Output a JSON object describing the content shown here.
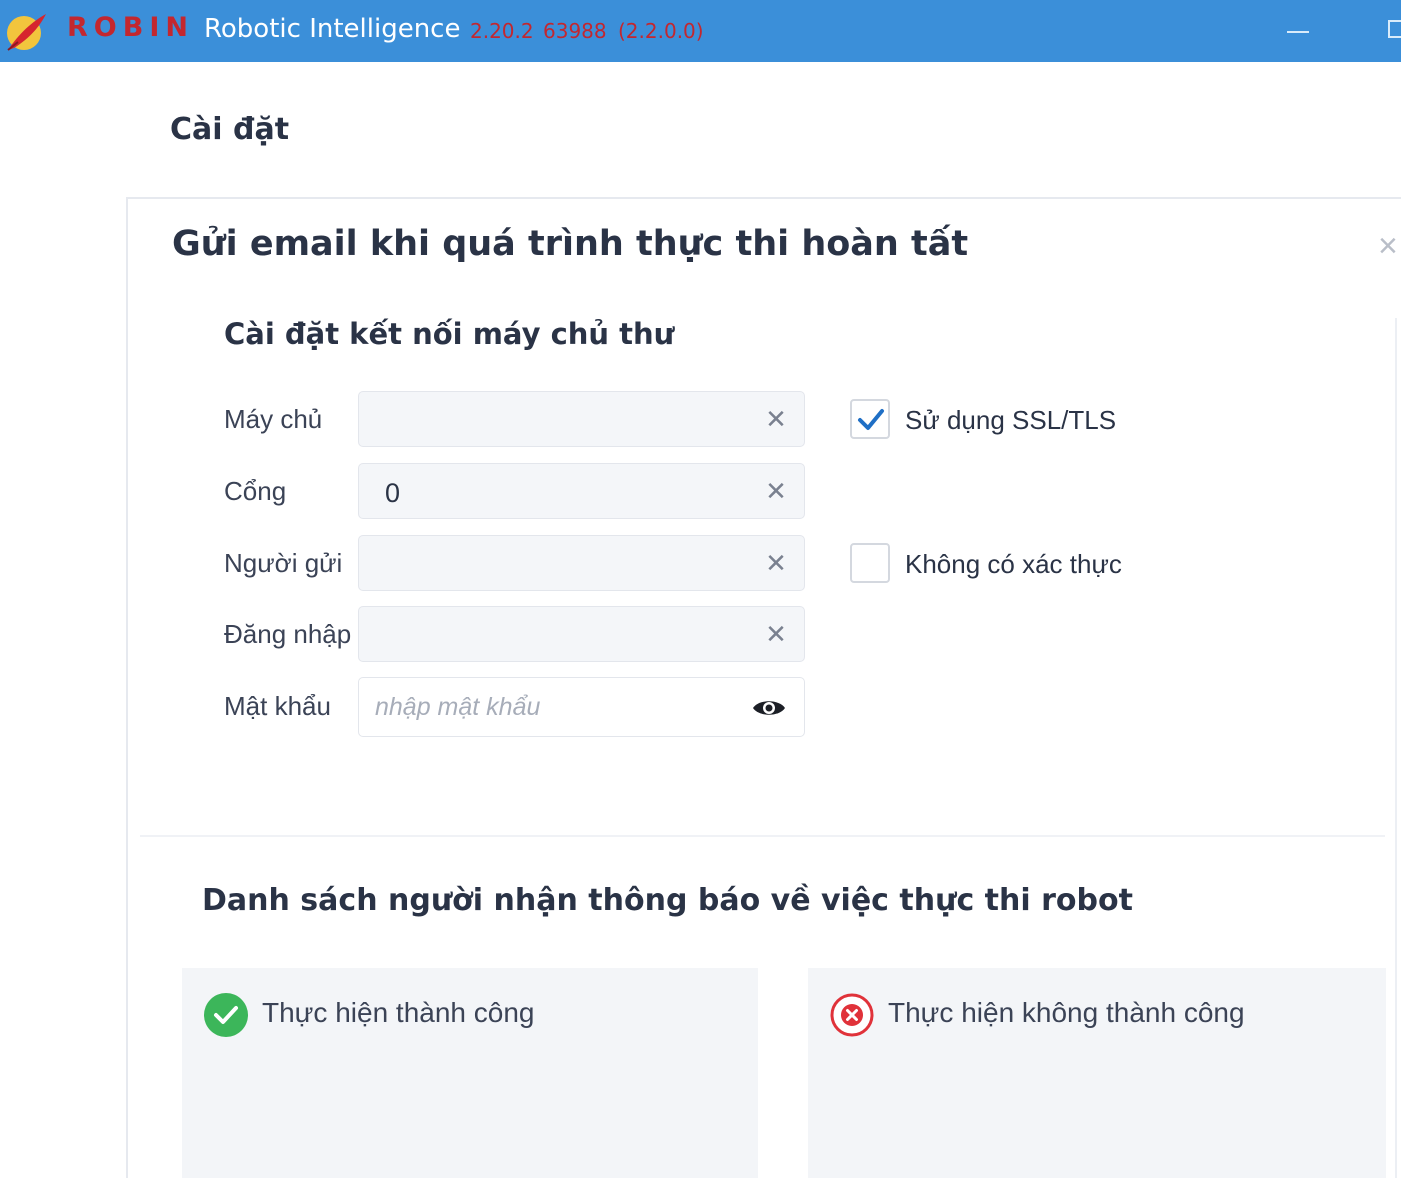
{
  "window": {
    "brand": "ROBIN",
    "app_name": "Robotic Intelligence",
    "version": "2.20.2",
    "build": "63988",
    "sub_version": "(2.2.0.0)",
    "icons": [
      "feather-logo-icon",
      "minimize-icon",
      "maximize-icon"
    ]
  },
  "page": {
    "title": "Cài đặt"
  },
  "panel": {
    "title": "Gửi email khi quá trình thực thi hoàn tất",
    "close_icon": "close-icon",
    "server_section": {
      "title": "Cài đặt kết nối máy chủ thư",
      "fields": {
        "server": {
          "label": "Máy chủ",
          "value": ""
        },
        "port": {
          "label": "Cổng",
          "value": "0"
        },
        "sender": {
          "label": "Người gửi",
          "value": ""
        },
        "login": {
          "label": "Đăng nhập",
          "value": ""
        },
        "password": {
          "label": "Mật khẩu",
          "value": "",
          "placeholder": "nhập mật khẩu"
        }
      },
      "use_ssl": {
        "label": "Sử dụng SSL/TLS",
        "checked": true
      },
      "no_auth": {
        "label": "Không có xác thực",
        "checked": false
      }
    },
    "recipients": {
      "title": "Danh sách người nhận thông báo về việc thực thi robot",
      "success": {
        "label": "Thực hiện thành công",
        "icon": "check-circle-icon",
        "color": "#3cb65a"
      },
      "failure": {
        "label": "Thực hiện không thành công",
        "icon": "x-circle-icon",
        "color": "#e0323a"
      }
    }
  },
  "colors": {
    "titlebar": "#3b8fd9",
    "brand": "#c3272f",
    "text": "#2a3346",
    "checkbox_tick": "#1f6fc5"
  }
}
